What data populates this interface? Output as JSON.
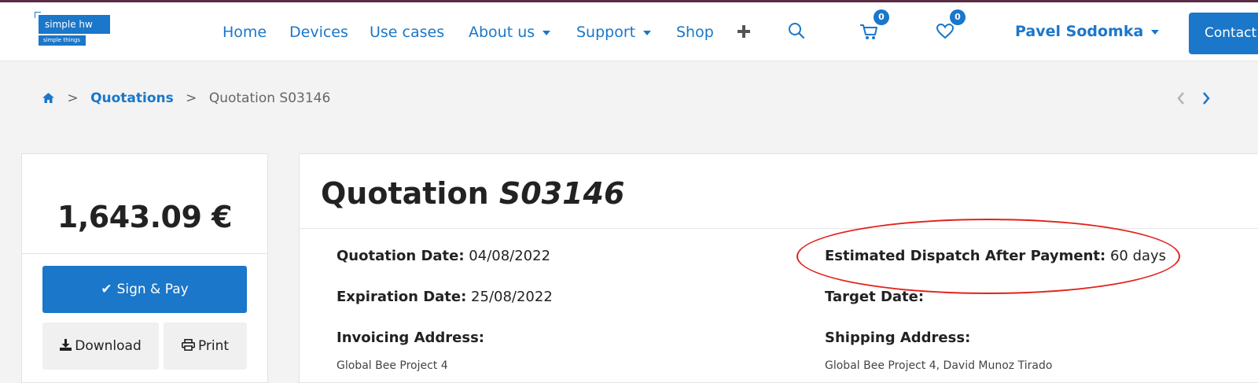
{
  "brand": {
    "logo_title": "simple hw",
    "logo_subtitle": "simple things",
    "accent_color": "#1a77c9"
  },
  "nav": {
    "home": "Home",
    "devices": "Devices",
    "use_cases": "Use cases",
    "about_us": "About us",
    "support": "Support",
    "shop": "Shop",
    "plus_icon": "plus-icon",
    "search_icon": "search-icon",
    "cart_icon": "cart-icon",
    "cart_count": "0",
    "wishlist_icon": "heart-icon",
    "wishlist_count": "0",
    "user_name": "Pavel Sodomka",
    "contact": "Contact"
  },
  "breadcrumb": {
    "home_icon": "home-icon",
    "separator": ">",
    "quotations": "Quotations",
    "current": "Quotation S03146"
  },
  "sidebar": {
    "amount": "1,643.09 €",
    "sign_pay_label": "Sign & Pay",
    "download_label": "Download",
    "print_label": "Print"
  },
  "quotation": {
    "title_prefix": "Quotation",
    "number": "S03146",
    "quotation_date_label": "Quotation Date:",
    "quotation_date": "04/08/2022",
    "expiration_date_label": "Expiration Date:",
    "expiration_date": "25/08/2022",
    "invoicing_address_label": "Invoicing Address:",
    "invoicing_address_partial": "Global Bee Project 4",
    "dispatch_label": "Estimated Dispatch After Payment:",
    "dispatch_value": "60 days",
    "target_date_label": "Target Date:",
    "shipping_address_label": "Shipping Address:",
    "shipping_address_partial": "Global Bee Project 4, David Munoz Tirado"
  },
  "annotation_color": "#e2231a"
}
